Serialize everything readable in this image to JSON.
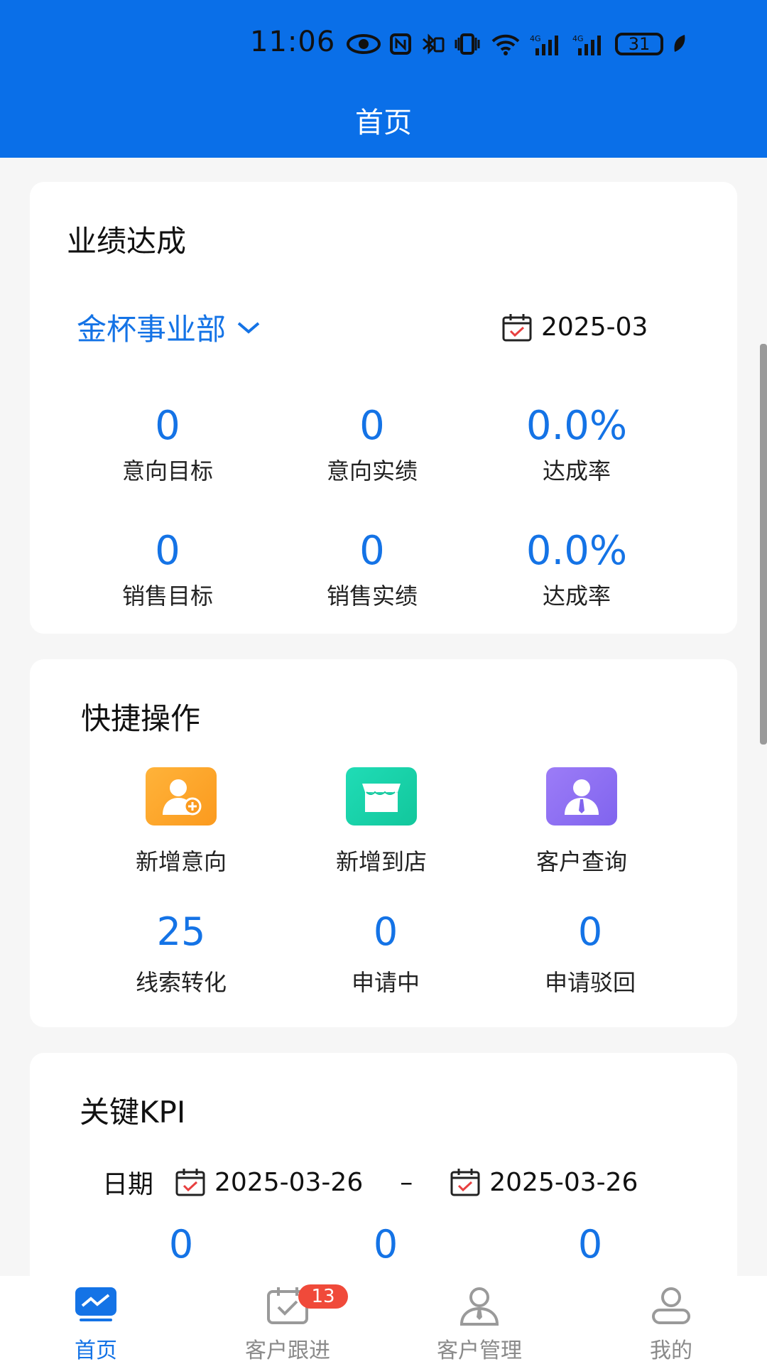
{
  "status_bar": {
    "time": "11:06",
    "battery": "31"
  },
  "header": {
    "title": "首页"
  },
  "performance": {
    "title": "业绩达成",
    "department": "金杯事业部",
    "month": "2025-03",
    "metrics": [
      {
        "value": "0",
        "label": "意向目标"
      },
      {
        "value": "0",
        "label": "意向实绩"
      },
      {
        "value": "0.0%",
        "label": "达成率"
      },
      {
        "value": "0",
        "label": "销售目标"
      },
      {
        "value": "0",
        "label": "销售实绩"
      },
      {
        "value": "0.0%",
        "label": "达成率"
      }
    ]
  },
  "quick_actions": {
    "title": "快捷操作",
    "actions": [
      {
        "label": "新增意向",
        "icon": "add-user-icon",
        "color": "#fda52a"
      },
      {
        "label": "新增到店",
        "icon": "store-icon",
        "color": "#18d2a8"
      },
      {
        "label": "客户查询",
        "icon": "customer-icon",
        "color": "#8f73f2"
      }
    ],
    "stats": [
      {
        "value": "25",
        "label": "线索转化"
      },
      {
        "value": "0",
        "label": "申请中"
      },
      {
        "value": "0",
        "label": "申请驳回"
      }
    ]
  },
  "kpi": {
    "title": "关键KPI",
    "date_label": "日期",
    "start_date": "2025-03-26",
    "separator": "–",
    "end_date": "2025-03-26",
    "values": [
      "0",
      "0",
      "0"
    ]
  },
  "tabbar": {
    "tabs": [
      {
        "label": "首页",
        "icon": "home-chart-icon"
      },
      {
        "label": "客户跟进",
        "icon": "calendar-check-icon",
        "badge": "13"
      },
      {
        "label": "客户管理",
        "icon": "customer-manage-icon"
      },
      {
        "label": "我的",
        "icon": "profile-icon"
      }
    ]
  },
  "colors": {
    "primary": "#0a6fe8",
    "accent": "#1473e6",
    "badge": "#f04a3a"
  }
}
